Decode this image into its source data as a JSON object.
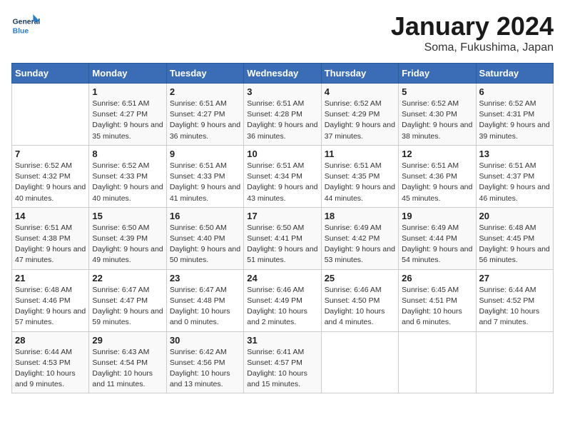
{
  "logo": {
    "general": "General",
    "blue": "Blue"
  },
  "title": "January 2024",
  "subtitle": "Soma, Fukushima, Japan",
  "days_header": [
    "Sunday",
    "Monday",
    "Tuesday",
    "Wednesday",
    "Thursday",
    "Friday",
    "Saturday"
  ],
  "weeks": [
    [
      {
        "day": "",
        "sunrise": "",
        "sunset": "",
        "daylight": ""
      },
      {
        "day": "1",
        "sunrise": "Sunrise: 6:51 AM",
        "sunset": "Sunset: 4:27 PM",
        "daylight": "Daylight: 9 hours and 35 minutes."
      },
      {
        "day": "2",
        "sunrise": "Sunrise: 6:51 AM",
        "sunset": "Sunset: 4:27 PM",
        "daylight": "Daylight: 9 hours and 36 minutes."
      },
      {
        "day": "3",
        "sunrise": "Sunrise: 6:51 AM",
        "sunset": "Sunset: 4:28 PM",
        "daylight": "Daylight: 9 hours and 36 minutes."
      },
      {
        "day": "4",
        "sunrise": "Sunrise: 6:52 AM",
        "sunset": "Sunset: 4:29 PM",
        "daylight": "Daylight: 9 hours and 37 minutes."
      },
      {
        "day": "5",
        "sunrise": "Sunrise: 6:52 AM",
        "sunset": "Sunset: 4:30 PM",
        "daylight": "Daylight: 9 hours and 38 minutes."
      },
      {
        "day": "6",
        "sunrise": "Sunrise: 6:52 AM",
        "sunset": "Sunset: 4:31 PM",
        "daylight": "Daylight: 9 hours and 39 minutes."
      }
    ],
    [
      {
        "day": "7",
        "sunrise": "Sunrise: 6:52 AM",
        "sunset": "Sunset: 4:32 PM",
        "daylight": "Daylight: 9 hours and 40 minutes."
      },
      {
        "day": "8",
        "sunrise": "Sunrise: 6:52 AM",
        "sunset": "Sunset: 4:33 PM",
        "daylight": "Daylight: 9 hours and 40 minutes."
      },
      {
        "day": "9",
        "sunrise": "Sunrise: 6:51 AM",
        "sunset": "Sunset: 4:33 PM",
        "daylight": "Daylight: 9 hours and 41 minutes."
      },
      {
        "day": "10",
        "sunrise": "Sunrise: 6:51 AM",
        "sunset": "Sunset: 4:34 PM",
        "daylight": "Daylight: 9 hours and 43 minutes."
      },
      {
        "day": "11",
        "sunrise": "Sunrise: 6:51 AM",
        "sunset": "Sunset: 4:35 PM",
        "daylight": "Daylight: 9 hours and 44 minutes."
      },
      {
        "day": "12",
        "sunrise": "Sunrise: 6:51 AM",
        "sunset": "Sunset: 4:36 PM",
        "daylight": "Daylight: 9 hours and 45 minutes."
      },
      {
        "day": "13",
        "sunrise": "Sunrise: 6:51 AM",
        "sunset": "Sunset: 4:37 PM",
        "daylight": "Daylight: 9 hours and 46 minutes."
      }
    ],
    [
      {
        "day": "14",
        "sunrise": "Sunrise: 6:51 AM",
        "sunset": "Sunset: 4:38 PM",
        "daylight": "Daylight: 9 hours and 47 minutes."
      },
      {
        "day": "15",
        "sunrise": "Sunrise: 6:50 AM",
        "sunset": "Sunset: 4:39 PM",
        "daylight": "Daylight: 9 hours and 49 minutes."
      },
      {
        "day": "16",
        "sunrise": "Sunrise: 6:50 AM",
        "sunset": "Sunset: 4:40 PM",
        "daylight": "Daylight: 9 hours and 50 minutes."
      },
      {
        "day": "17",
        "sunrise": "Sunrise: 6:50 AM",
        "sunset": "Sunset: 4:41 PM",
        "daylight": "Daylight: 9 hours and 51 minutes."
      },
      {
        "day": "18",
        "sunrise": "Sunrise: 6:49 AM",
        "sunset": "Sunset: 4:42 PM",
        "daylight": "Daylight: 9 hours and 53 minutes."
      },
      {
        "day": "19",
        "sunrise": "Sunrise: 6:49 AM",
        "sunset": "Sunset: 4:44 PM",
        "daylight": "Daylight: 9 hours and 54 minutes."
      },
      {
        "day": "20",
        "sunrise": "Sunrise: 6:48 AM",
        "sunset": "Sunset: 4:45 PM",
        "daylight": "Daylight: 9 hours and 56 minutes."
      }
    ],
    [
      {
        "day": "21",
        "sunrise": "Sunrise: 6:48 AM",
        "sunset": "Sunset: 4:46 PM",
        "daylight": "Daylight: 9 hours and 57 minutes."
      },
      {
        "day": "22",
        "sunrise": "Sunrise: 6:47 AM",
        "sunset": "Sunset: 4:47 PM",
        "daylight": "Daylight: 9 hours and 59 minutes."
      },
      {
        "day": "23",
        "sunrise": "Sunrise: 6:47 AM",
        "sunset": "Sunset: 4:48 PM",
        "daylight": "Daylight: 10 hours and 0 minutes."
      },
      {
        "day": "24",
        "sunrise": "Sunrise: 6:46 AM",
        "sunset": "Sunset: 4:49 PM",
        "daylight": "Daylight: 10 hours and 2 minutes."
      },
      {
        "day": "25",
        "sunrise": "Sunrise: 6:46 AM",
        "sunset": "Sunset: 4:50 PM",
        "daylight": "Daylight: 10 hours and 4 minutes."
      },
      {
        "day": "26",
        "sunrise": "Sunrise: 6:45 AM",
        "sunset": "Sunset: 4:51 PM",
        "daylight": "Daylight: 10 hours and 6 minutes."
      },
      {
        "day": "27",
        "sunrise": "Sunrise: 6:44 AM",
        "sunset": "Sunset: 4:52 PM",
        "daylight": "Daylight: 10 hours and 7 minutes."
      }
    ],
    [
      {
        "day": "28",
        "sunrise": "Sunrise: 6:44 AM",
        "sunset": "Sunset: 4:53 PM",
        "daylight": "Daylight: 10 hours and 9 minutes."
      },
      {
        "day": "29",
        "sunrise": "Sunrise: 6:43 AM",
        "sunset": "Sunset: 4:54 PM",
        "daylight": "Daylight: 10 hours and 11 minutes."
      },
      {
        "day": "30",
        "sunrise": "Sunrise: 6:42 AM",
        "sunset": "Sunset: 4:56 PM",
        "daylight": "Daylight: 10 hours and 13 minutes."
      },
      {
        "day": "31",
        "sunrise": "Sunrise: 6:41 AM",
        "sunset": "Sunset: 4:57 PM",
        "daylight": "Daylight: 10 hours and 15 minutes."
      },
      {
        "day": "",
        "sunrise": "",
        "sunset": "",
        "daylight": ""
      },
      {
        "day": "",
        "sunrise": "",
        "sunset": "",
        "daylight": ""
      },
      {
        "day": "",
        "sunrise": "",
        "sunset": "",
        "daylight": ""
      }
    ]
  ]
}
